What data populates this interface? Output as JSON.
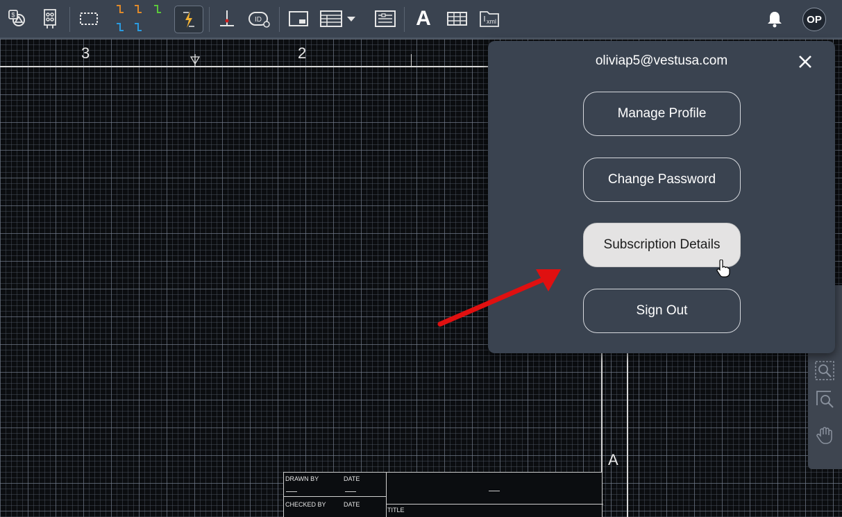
{
  "toolbar": {
    "text_tool_glyph": "A",
    "xml_label": "xml",
    "id_label": "ID",
    "items": [
      {
        "name": "symbol-library-icon"
      },
      {
        "name": "terminal-block-icon"
      },
      {
        "name": "selection-box-icon"
      },
      {
        "name": "wire-numbers-icon"
      },
      {
        "name": "wire-tool-icon"
      },
      {
        "name": "insert-component-icon"
      },
      {
        "name": "tag-id-icon"
      },
      {
        "name": "panel-layout-icon"
      },
      {
        "name": "report-table-icon"
      },
      {
        "name": "bom-report-icon"
      },
      {
        "name": "text-tool-icon"
      },
      {
        "name": "table-tool-icon"
      },
      {
        "name": "export-xml-icon"
      }
    ],
    "avatar_initials": "OP"
  },
  "drawing": {
    "zone_labels": [
      "3",
      "2"
    ],
    "row_label": "A",
    "title_block": {
      "drawn_by": "DRAWN BY",
      "date1": "DATE",
      "checked_by": "CHECKED BY",
      "date2": "DATE",
      "title": "TITLE"
    }
  },
  "profile_menu": {
    "email": "oliviap5@vestusa.com",
    "buttons": [
      {
        "label": "Manage Profile"
      },
      {
        "label": "Change Password"
      },
      {
        "label": "Subscription Details",
        "hovered": true
      },
      {
        "label": "Sign Out"
      }
    ]
  },
  "colors": {
    "toolbar_bg": "#3a4350",
    "popup_bg": "#3a4350",
    "canvas_bg": "#0b0d10",
    "hover_button_bg": "#e4e3e3",
    "annotation_arrow": "#e01010",
    "wire_orange": "#e08a2a",
    "wire_blue": "#2a9be0",
    "wire_green": "#5ac83a"
  }
}
